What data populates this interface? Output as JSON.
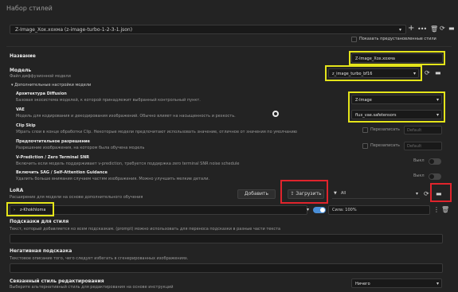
{
  "dialog_title": "Набор стилей",
  "preset": {
    "value": "Z-Image_Xox.хохма (z-image-turbo-1-2-3-1.json)",
    "show_predefined_label": "Показать предустановленные стили"
  },
  "name": {
    "label": "Название",
    "value": "Z-Image_Xox.хохма"
  },
  "model": {
    "label": "Модель",
    "sublabel": "Файл диффузионной модели",
    "value": "z_image_turbo_bf16"
  },
  "advanced": {
    "header": "Дополнительные настройки модели",
    "arch_label": "Архитектура Diffusion",
    "arch_desc": "Базовая экосистема моделей, к которой принадлежит выбранный контрольный пункт.",
    "arch_value": "Z-Image",
    "vae_label": "VAE",
    "vae_desc": "Модель для кодирования и декодирования изображений. Обычно влияет на насыщенность и резкость.",
    "vae_value": "flux_vae.safetensors",
    "clip_label": "Clip Skip",
    "clip_desc": "Убрать слои в конце обработки Clip. Некоторые модели предпочитают использовать значение, отличное от значения по умолчанию",
    "override_label": "Перезаписать",
    "default_placeholder": "Default",
    "res_label": "Предпочтительное разрешение",
    "res_desc": "Разрешение изображения, на котором была обучена модель",
    "vpred_label": "V-Prediction / Zero Terminal SNR",
    "vpred_desc": "Включить если модель поддерживает v-prediction, требуется поддержка zero terminal SNR noise schedule",
    "off_label": "Выкл",
    "sag_label": "Включить SAG / Self-Attention Guidance",
    "sag_desc": "Удалить больше внимания случаем частям изображения. Можно улучшить мелкие детали."
  },
  "lora": {
    "label": "LoRA",
    "desc": "Расширение для модели на основе дополнительного обучения",
    "add_label": "Добавить",
    "load_label": "Загрузить",
    "filter_value": "All",
    "item_name": "z-Khokhloma",
    "strength_label": "Сила: 100%"
  },
  "style_prompt": {
    "label": "Подсказки для стиля",
    "desc": "Текст, который добавляется ко всем подсказкам. (prompt) можно использовать для переноса подсказки в разные части текста"
  },
  "negative": {
    "label": "Негативная подсказка",
    "desc": "Текстовое описание того, чего следует избегать в сгенерированных изображениях."
  },
  "edit_style": {
    "label": "Связанный стиль редактирования",
    "desc": "Выберите альтернативный стиль для редактирования на основе инструкций",
    "value": "Ничего"
  },
  "icons": {
    "add": "plus-icon",
    "more": "dots-icon",
    "delete": "trash-icon",
    "refresh": "refresh-icon",
    "folder": "folder-icon",
    "chevron": "chevron-down-icon"
  },
  "colors": {
    "highlight_yellow": "#e4e41a",
    "highlight_red": "#e0242c",
    "toggle_on": "#4a8fd8"
  }
}
